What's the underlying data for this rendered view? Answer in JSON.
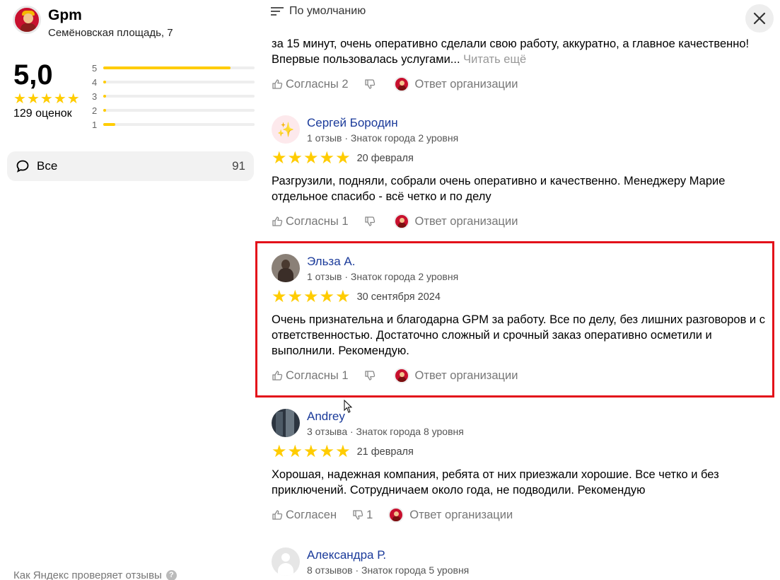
{
  "org": {
    "name": "Gpm",
    "address": "Семёновская площадь, 7"
  },
  "rating": {
    "value": "5,0",
    "count_label": "129 оценок",
    "distribution": [
      {
        "star": "5",
        "fraction": 0.84
      },
      {
        "star": "4",
        "fraction": 0.02
      },
      {
        "star": "3",
        "fraction": 0.02
      },
      {
        "star": "2",
        "fraction": 0.02
      },
      {
        "star": "1",
        "fraction": 0.08
      }
    ]
  },
  "filter": {
    "label": "Все",
    "count": "91"
  },
  "how_check": "Как Яндекс проверяет отзывы",
  "sort": {
    "label": "По умолчанию"
  },
  "colors": {
    "star": "#ffcc00",
    "highlight": "#e3101a",
    "author": "#1a3a9a"
  },
  "reply_label": "Ответ организации",
  "reviews": [
    {
      "partial": true,
      "text": "за 15 минут, очень оперативно сделали свою работу, аккуратно, а главное качественно! Впервые пользовалась услугами...",
      "more": "Читать ещё",
      "agree": "Согласны 2",
      "dislike": ""
    },
    {
      "name": "Сергей Бородин",
      "meta": "1 отзыв · Знаток города 2 уровня",
      "avatar_icon": "sparkles-icon",
      "stars": 5,
      "date": "20 февраля",
      "text": "Разгрузили, подняли, собрали очень оперативно и качественно. Менеджеру Марие отдельное спасибо - всё четко и по делу",
      "agree": "Согласны 1",
      "dislike": ""
    },
    {
      "name": "Эльза А.",
      "meta": "1 отзыв · Знаток города 2 уровня",
      "avatar_icon": "user-photo",
      "stars": 5,
      "date": "30 сентября 2024",
      "text": "Очень признательна и благодарна GPM за работу. Все по делу, без лишних разговоров и с ответственностью. Достаточно сложный и срочный заказ оперативно осметили и выполнили. Рекомендую.",
      "agree": "Согласны 1",
      "dislike": ""
    },
    {
      "name": "Andrey",
      "meta": "3 отзыва · Знаток города 8 уровня",
      "avatar_icon": "user-photo",
      "stars": 5,
      "date": "21 февраля",
      "text": "Хорошая, надежная компания, ребята от них приезжали хорошие. Все четко и без приключений. Сотрудничаем около года, не подводили. Рекомендую",
      "agree": "Согласен",
      "dislike": "1"
    },
    {
      "name": "Александра Р.",
      "meta": "8 отзывов · Знаток города 5 уровня",
      "avatar_icon": "default-user-icon"
    }
  ]
}
